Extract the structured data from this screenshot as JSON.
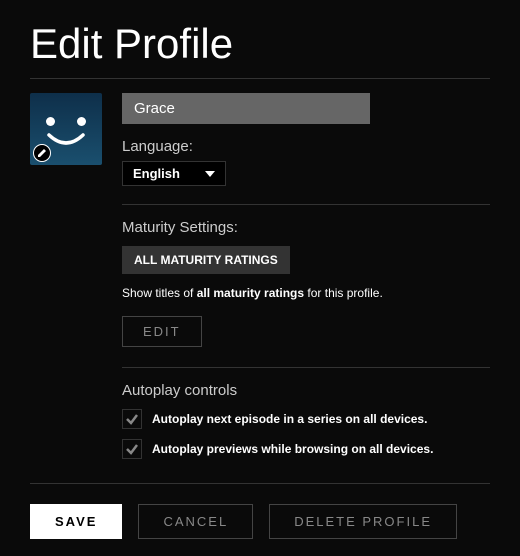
{
  "title": "Edit Profile",
  "profile": {
    "name": "Grace"
  },
  "language": {
    "label": "Language:",
    "selected": "English"
  },
  "maturity": {
    "label": "Maturity Settings:",
    "badge": "ALL MATURITY RATINGS",
    "desc_prefix": "Show titles of ",
    "desc_bold": "all maturity ratings",
    "desc_suffix": " for this profile.",
    "edit_label": "EDIT"
  },
  "autoplay": {
    "label": "Autoplay controls",
    "options": [
      "Autoplay next episode in a series on all devices.",
      "Autoplay previews while browsing on all devices."
    ]
  },
  "buttons": {
    "save": "SAVE",
    "cancel": "CANCEL",
    "delete": "DELETE PROFILE"
  }
}
